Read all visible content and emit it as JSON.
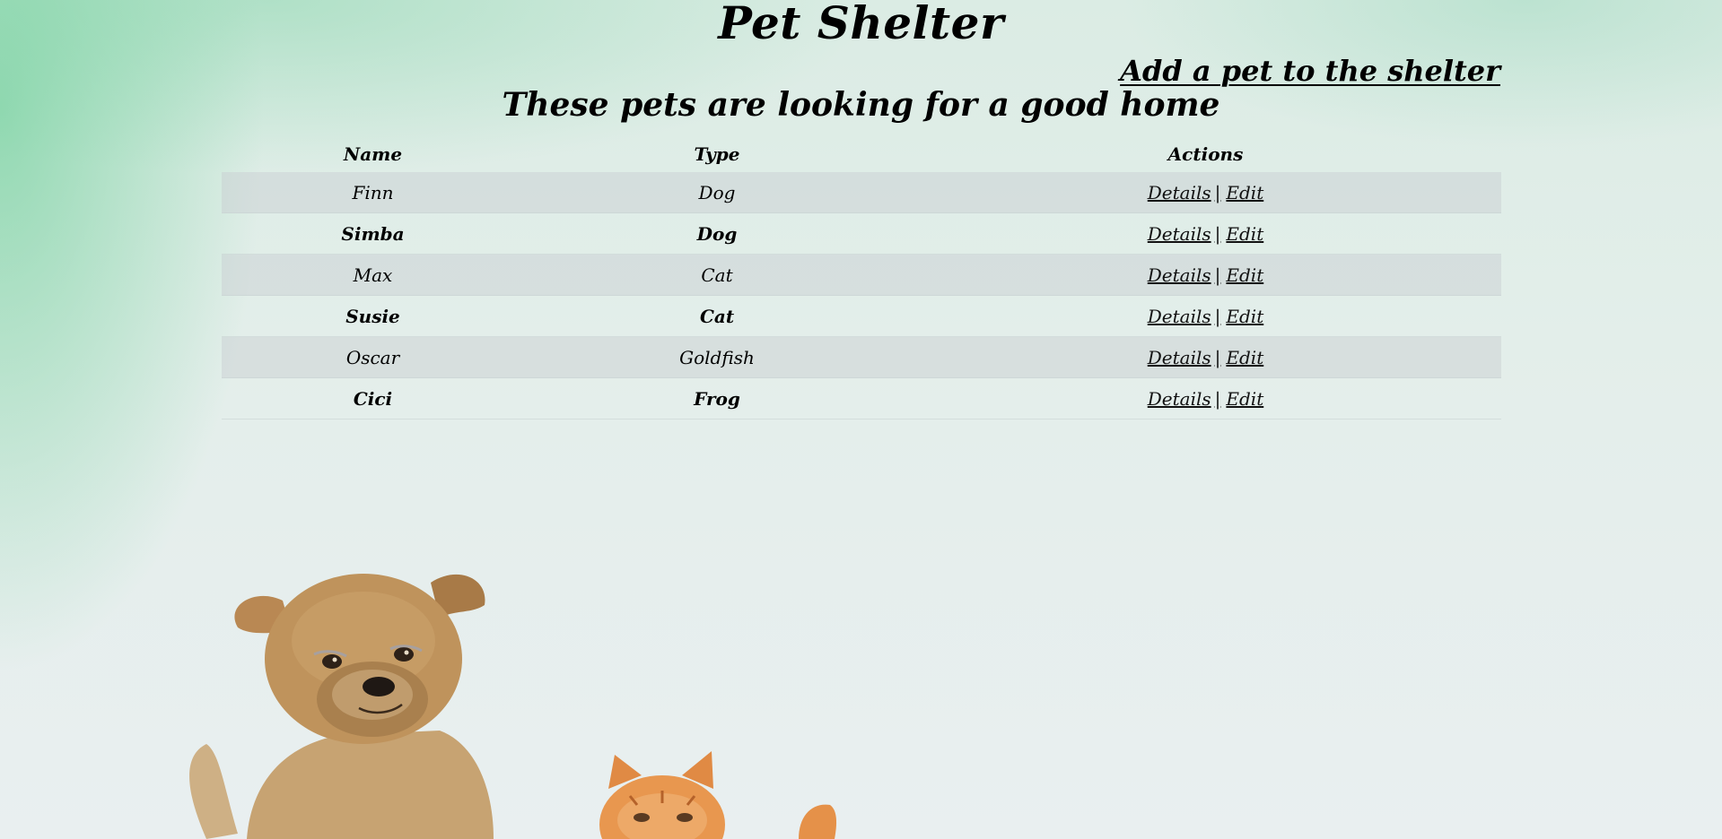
{
  "header": {
    "title": "Pet Shelter",
    "add_link": "Add a pet to the shelter",
    "subtitle": "These pets are looking for a good home"
  },
  "table": {
    "columns": [
      "Name",
      "Type",
      "Actions"
    ],
    "rows": [
      {
        "name": "Finn",
        "type": "Dog",
        "details": "Details",
        "sep": "|",
        "edit": "Edit"
      },
      {
        "name": "Simba",
        "type": "Dog",
        "details": "Details",
        "sep": "|",
        "edit": "Edit"
      },
      {
        "name": "Max",
        "type": "Cat",
        "details": "Details",
        "sep": "|",
        "edit": "Edit"
      },
      {
        "name": "Susie",
        "type": "Cat",
        "details": "Details",
        "sep": "|",
        "edit": "Edit"
      },
      {
        "name": "Oscar",
        "type": "Goldfish",
        "details": "Details",
        "sep": "|",
        "edit": "Edit"
      },
      {
        "name": "Cici",
        "type": "Frog",
        "details": "Details",
        "sep": "|",
        "edit": "Edit"
      }
    ]
  },
  "colors": {
    "background": "#e3eeea",
    "accent_green": "#78d2a0",
    "row_stripe": "#d4d9db",
    "dog_fur": "#b48a55",
    "cat_fur": "#e39a52"
  },
  "icons": {
    "illustration": "dog-and-cat-illustration"
  }
}
